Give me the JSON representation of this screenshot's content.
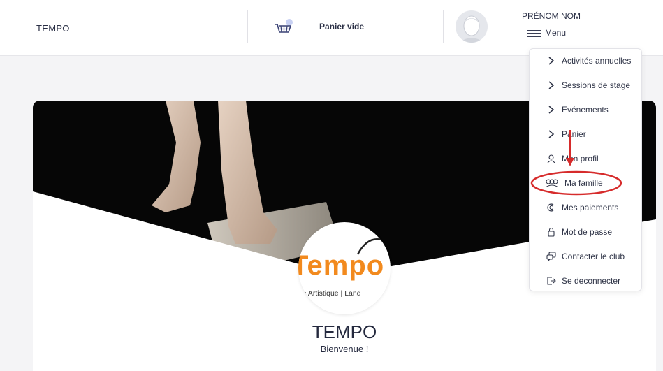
{
  "header": {
    "brand": "TEMPO",
    "cart_label": "Panier vide",
    "user_name": "PRÉNOM NOM",
    "menu_label": "Menu"
  },
  "menu": {
    "items": [
      {
        "label": "Activités annuelles",
        "icon": "chevron-right-icon"
      },
      {
        "label": "Sessions de stage",
        "icon": "chevron-right-icon"
      },
      {
        "label": "Evénements",
        "icon": "chevron-right-icon"
      },
      {
        "label": "Panier",
        "icon": "chevron-right-icon"
      },
      {
        "label": "Mon profil",
        "icon": "user-icon"
      },
      {
        "label": "Ma famille",
        "icon": "family-icon"
      },
      {
        "label": "Mes paiements",
        "icon": "payment-icon"
      },
      {
        "label": "Mot de passe",
        "icon": "lock-icon"
      },
      {
        "label": "Contacter le club",
        "icon": "chat-icon"
      },
      {
        "label": "Se deconnecter",
        "icon": "logout-icon"
      }
    ]
  },
  "club": {
    "logo_word": "Tempo",
    "logo_subtitle": "que Artistique | Land",
    "name": "TEMPO",
    "welcome": "Bienvenue !"
  },
  "colors": {
    "accent": "#f28a1e",
    "highlight": "#d62b2b",
    "text": "#2a2f45"
  }
}
